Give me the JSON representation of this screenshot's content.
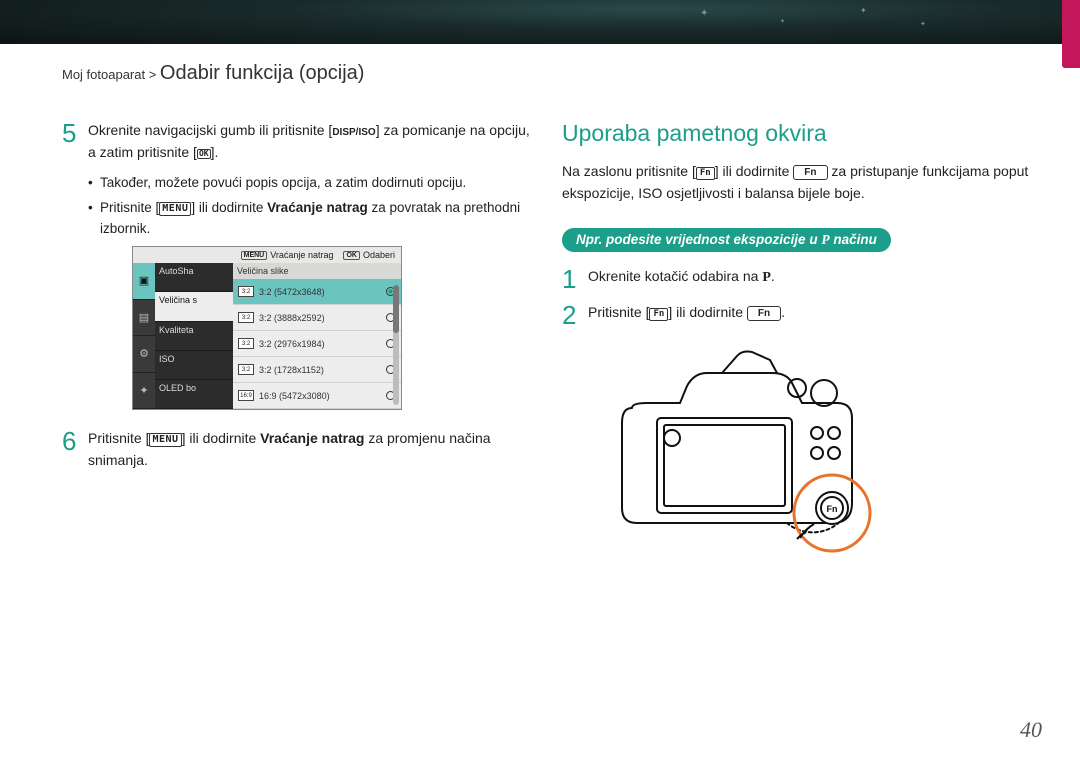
{
  "breadcrumb": {
    "prefix": "Moj fotoaparat > ",
    "section": "Odabir funkcija (opcija)"
  },
  "left": {
    "step5": {
      "num": "5",
      "text_a": "Okrenite navigacijski gumb ili pritisnite [",
      "text_b": "] za pomicanje na opciju, a zatim pritisnite [",
      "text_c": "]."
    },
    "bullet1": "Također, možete povući popis opcija, a zatim dodirnuti opciju.",
    "bullet2_a": "Pritisnite [",
    "bullet2_b": "] ili dodirnite ",
    "bullet2_bold": "Vraćanje natrag",
    "bullet2_c": " za povratak na prethodni izbornik.",
    "step6": {
      "num": "6",
      "text_a": "Pritisnite [",
      "text_b": "] ili dodirnite ",
      "bold": "Vraćanje natrag",
      "text_c": " za promjenu načina snimanja."
    }
  },
  "lcd": {
    "top_back": "Vraćanje natrag",
    "top_sel": "Odaberi",
    "menu": [
      "AutoSha",
      "Veličina s",
      "Kvaliteta",
      "ISO",
      "OLED bo"
    ],
    "list_header": "Veličina slike",
    "rows": [
      {
        "ratio": "3:2",
        "res": "(5472x3648)",
        "sel": true
      },
      {
        "ratio": "3:2",
        "res": "(3888x2592)",
        "sel": false
      },
      {
        "ratio": "3:2",
        "res": "(2976x1984)",
        "sel": false
      },
      {
        "ratio": "3:2",
        "res": "(1728x1152)",
        "sel": false
      },
      {
        "ratio": "16:9",
        "res": "(5472x3080)",
        "sel": false
      }
    ]
  },
  "right": {
    "title": "Uporaba pametnog okvira",
    "intro_a": "Na zaslonu pritisnite [",
    "intro_b": "] ili dodirnite ",
    "intro_c": " za pristupanje funkcijama poput ekspozicije, ISO osjetljivosti i balansa bijele boje.",
    "pill_a": "Npr. podesite vrijednost ekspozicije u ",
    "pill_b": " načinu",
    "step1": {
      "num": "1",
      "text_a": "Okrenite kotačić odabira na ",
      "text_b": "."
    },
    "step2": {
      "num": "2",
      "text_a": "Pritisnite [",
      "text_b": "] ili dodirnite ",
      "text_c": "."
    }
  },
  "icons": {
    "disp_iso": "DISP/ISO",
    "ok": "OK",
    "menu": "MENU",
    "fn": "Fn",
    "p": "P"
  },
  "page": "40"
}
